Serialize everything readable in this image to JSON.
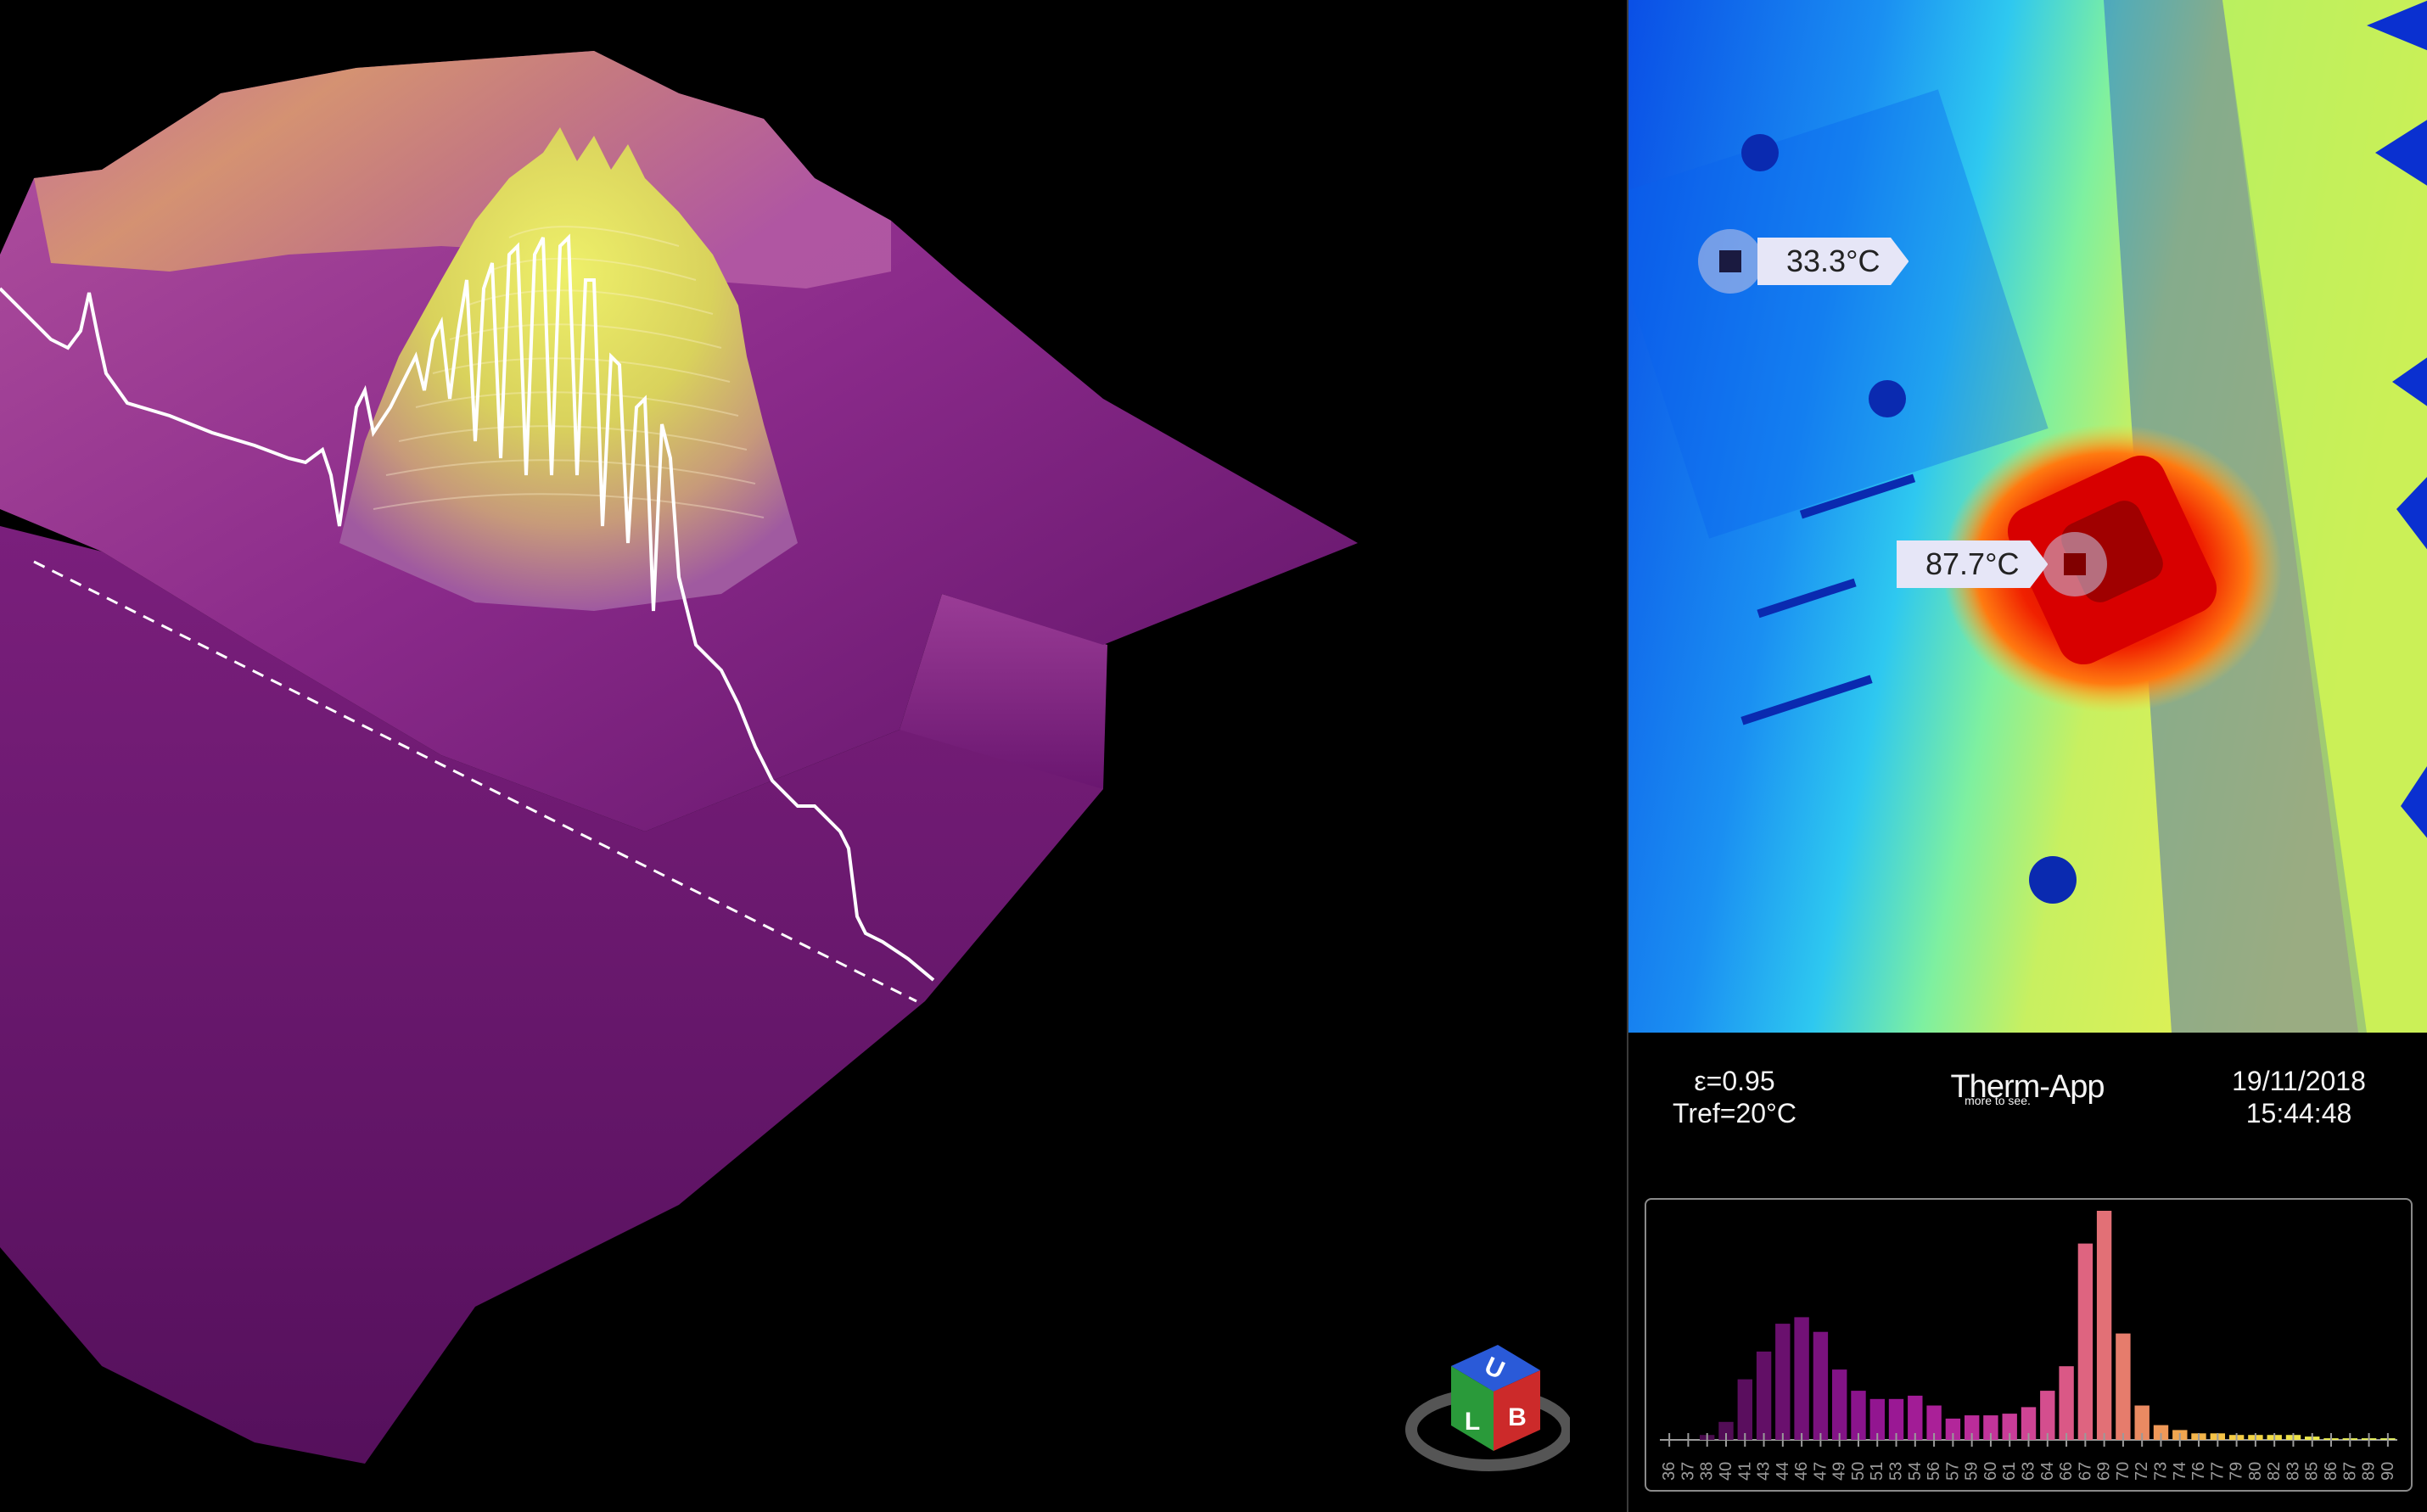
{
  "thermal": {
    "spots": [
      {
        "name": "spot-cold",
        "value": "33.3°C"
      },
      {
        "name": "spot-hot",
        "value": "87.7°C"
      }
    ],
    "info": {
      "emissivity": "ε=0.95",
      "tref": "Tref=20°C",
      "brand": "Therm-App",
      "tagline": "more to see.",
      "date": "19/11/2018",
      "time": "15:44:48"
    }
  },
  "viewcube": {
    "faces": [
      "U",
      "L",
      "B"
    ]
  },
  "histogram": {
    "type": "bar",
    "tick_labels": [
      "36",
      "37",
      "38",
      "40",
      "41",
      "43",
      "44",
      "46",
      "47",
      "49",
      "50",
      "51",
      "53",
      "54",
      "56",
      "57",
      "59",
      "60",
      "61",
      "63",
      "64",
      "66",
      "67",
      "69",
      "70",
      "72",
      "73",
      "74",
      "76",
      "77",
      "79",
      "80",
      "82",
      "83",
      "85",
      "86",
      "87",
      "89",
      "90"
    ],
    "counts": [
      0,
      0,
      3,
      11,
      37,
      54,
      71,
      75,
      66,
      43,
      30,
      25,
      25,
      27,
      21,
      13,
      15,
      15,
      16,
      20,
      30,
      45,
      120,
      140,
      65,
      21,
      9,
      6,
      4,
      4,
      3,
      3,
      3,
      3,
      2,
      1,
      1,
      1,
      1
    ],
    "colors": [
      "#3a0a3e",
      "#420b46",
      "#4a0c4e",
      "#520d56",
      "#5a0e5e",
      "#620f66",
      "#6a106e",
      "#721176",
      "#7a127e",
      "#821386",
      "#8a148c",
      "#921590",
      "#9a1894",
      "#a21c96",
      "#aa2098",
      "#b2269a",
      "#ba2c9a",
      "#c2349a",
      "#c83c98",
      "#ce4494",
      "#d44e8e",
      "#da5886",
      "#de6480",
      "#e27076",
      "#e67c6c",
      "#ea8a62",
      "#ee9858",
      "#f0a650",
      "#f2b44a",
      "#f4c246",
      "#f4cc44",
      "#f2d444",
      "#f0dc46",
      "#eee248",
      "#ece84c",
      "#eaec52",
      "#e8ee58",
      "#e6f05e",
      "#e4f064"
    ]
  }
}
